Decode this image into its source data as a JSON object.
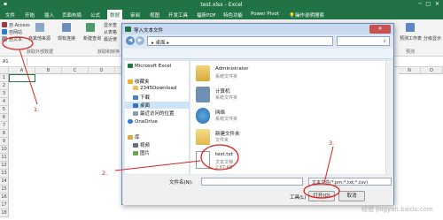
{
  "excel": {
    "title": "test.xlsx - Excel",
    "tabs": [
      "文件",
      "开始",
      "插入",
      "页面布局",
      "公式",
      "数据",
      "审阅",
      "视图",
      "开发工具",
      "福昕PDF",
      "特色功能",
      "Power Pivot",
      "操作说明搜索"
    ],
    "active_tab": "数据",
    "ribbon": {
      "access": "自 Access",
      "web": "自网站",
      "text": "自文本",
      "other_sources": "自其他来源",
      "existing": "现有连接",
      "new_query": "新建查询",
      "group_external": "获取外部数据",
      "show_query": "显示查",
      "from_table": "从表格",
      "recent": "最近使",
      "group_transform": "获取和转换",
      "forecast": "预测工作表",
      "group_forecast": "预测",
      "outline": "分级显示"
    },
    "name_box": "A1",
    "columns": [
      "A",
      "B",
      "C",
      "D",
      "E",
      "F",
      "G",
      "H",
      "I",
      "J",
      "K",
      "L",
      "M",
      "N",
      "O"
    ],
    "rows": [
      "1",
      "2",
      "3",
      "4",
      "5",
      "6",
      "7",
      "8",
      "9",
      "10",
      "11",
      "12",
      "13",
      "14",
      "15",
      "16",
      "17",
      "18"
    ]
  },
  "dialog": {
    "title": "导入文本文件",
    "address": "▸ 桌面 ▸",
    "nav": [
      {
        "label": "Microsoft Excel",
        "icon": "excel-icon"
      },
      {
        "label": "收藏夹",
        "icon": "star-icon"
      },
      {
        "label": "2345Download",
        "icon": "folder-icon"
      },
      {
        "label": "下载",
        "icon": "download-folder-icon"
      },
      {
        "label": "桌面",
        "icon": "desktop-icon"
      },
      {
        "label": "最近访问的位置",
        "icon": "recent-icon"
      },
      {
        "label": "OneDrive",
        "icon": "cloud-icon"
      },
      {
        "label": "库",
        "icon": "library-icon"
      },
      {
        "label": "视频",
        "icon": "video-icon"
      },
      {
        "label": "图片",
        "icon": "picture-icon"
      }
    ],
    "files": [
      {
        "name": "Administrator",
        "sub": "系统文件夹",
        "icon": "user-folder-icon"
      },
      {
        "name": "计算机",
        "sub": "系统文件夹",
        "icon": "computer-icon"
      },
      {
        "name": "网络",
        "sub": "系统文件夹",
        "icon": "network-icon"
      },
      {
        "name": "新建文件夹",
        "sub": "文件夹",
        "icon": "folder-icon"
      },
      {
        "name": "test.txt",
        "sub": "文本文档",
        "size": "2.67 KB",
        "icon": "text-file-icon"
      }
    ],
    "filename_label": "文件名(N):",
    "filetype": "文本文件(*.prn;*.txt;*.csv)",
    "tools": "工具(L)",
    "open": "打开(O)",
    "cancel": "取消"
  },
  "annotations": [
    "1.",
    "2.",
    "3."
  ],
  "watermark": "经验 jingyan.baidu.com"
}
